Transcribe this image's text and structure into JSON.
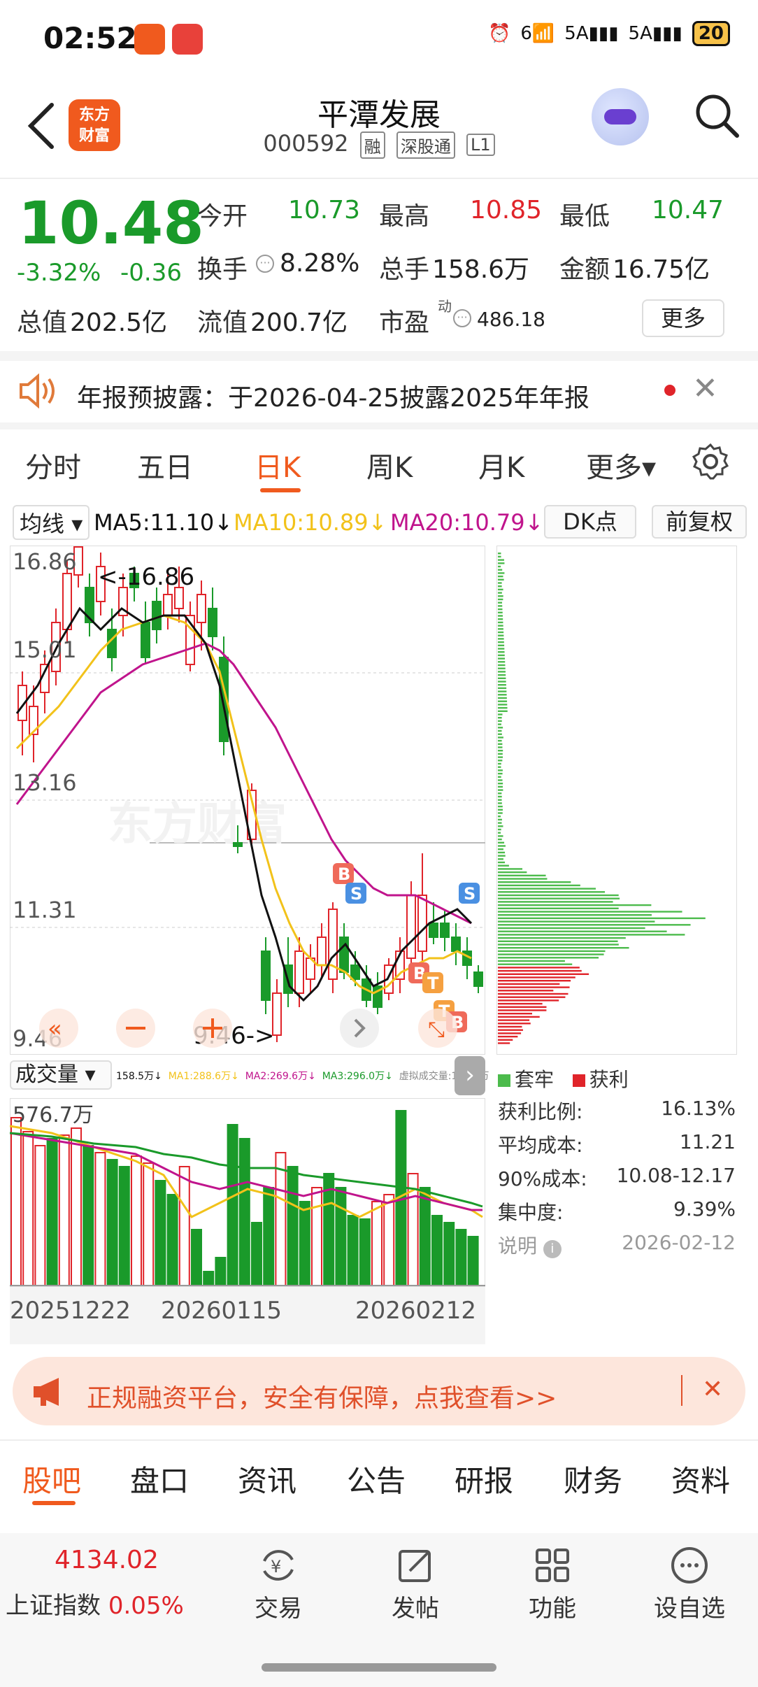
{
  "status_bar": {
    "time": "02:52",
    "battery": "20",
    "signal_1": "6",
    "signal_2": "5A",
    "signal_3": "5A"
  },
  "header": {
    "logo_line1": "东方",
    "logo_line2": "财富",
    "title": "平潭发展",
    "code": "000592",
    "tags": [
      "融",
      "深股通",
      "L1"
    ]
  },
  "quote": {
    "price": "10.48",
    "change_pct": "-3.32%",
    "change": "-0.36",
    "open_label": "今开",
    "open": "10.73",
    "high_label": "最高",
    "high": "10.85",
    "low_label": "最低",
    "low": "10.47",
    "turnover_label": "换手",
    "turnover": "8.28%",
    "volume_label": "总手",
    "volume": "158.6万",
    "amount_label": "金额",
    "amount": "16.75亿",
    "mktcap_label": "总值",
    "mktcap": "202.5亿",
    "float_label": "流值",
    "float_cap": "200.7亿",
    "pe_label": "市盈",
    "pe_sup": "动",
    "pe": "486.18",
    "more_label": "更多"
  },
  "notice": {
    "text": "年报预披露：于2026-04-25披露2025年年报"
  },
  "period_tabs": [
    "分时",
    "五日",
    "日K",
    "周K",
    "月K",
    "更多▾"
  ],
  "active_period": "日K",
  "ma_bar": {
    "select": "均线",
    "ma5": "MA5:11.10↓",
    "ma10": "MA10:10.89↓",
    "ma20": "MA20:10.79↓",
    "dk_button": "DK点",
    "adjust_button": "前复权"
  },
  "colors": {
    "up": "#e0242a",
    "down": "#1a9a2a",
    "ma5": "#111111",
    "ma10": "#f2c21a",
    "ma20": "#c0148c",
    "accent": "#f05a1e"
  },
  "kline": {
    "y_labels": [
      "16.86",
      "15.01",
      "13.16",
      "11.31",
      "9.46"
    ],
    "high_annot": "<-16.86",
    "low_annot": "9.46->",
    "watermark": "东方财富",
    "markers": [
      "B",
      "S",
      "S",
      "B",
      "T",
      "T",
      "B"
    ]
  },
  "volume_bar": {
    "select": "成交量",
    "vol": "158.5万↓",
    "ma1": "MA1:288.6万↓",
    "ma2": "MA2:269.6万↓",
    "ma3": "MA3:296.0万↓",
    "virtual": "虚拟成交量:167.7万",
    "max_label": "576.7万",
    "dates": [
      "20251222",
      "20260115",
      "20260212"
    ]
  },
  "chip": {
    "legend_trap": "套牢",
    "legend_profit": "获利",
    "rows": [
      {
        "label": "获利比例:",
        "value": "16.13%"
      },
      {
        "label": "平均成本:",
        "value": "11.21"
      },
      {
        "label": "90%成本:",
        "value": "10.08-12.17"
      },
      {
        "label": "集中度:",
        "value": "9.39%"
      }
    ],
    "note_label": "说明",
    "note_date": "2026-02-12"
  },
  "ad": {
    "text": "正规融资平台，安全有保障，点我查看>>"
  },
  "bottom_tabs": [
    "股吧",
    "盘口",
    "资讯",
    "公告",
    "研报",
    "财务",
    "资料"
  ],
  "index": {
    "value": "4134.02",
    "name": "上证指数",
    "pct": "0.05%"
  },
  "nav": [
    "交易",
    "发帖",
    "功能",
    "设自选"
  ]
}
